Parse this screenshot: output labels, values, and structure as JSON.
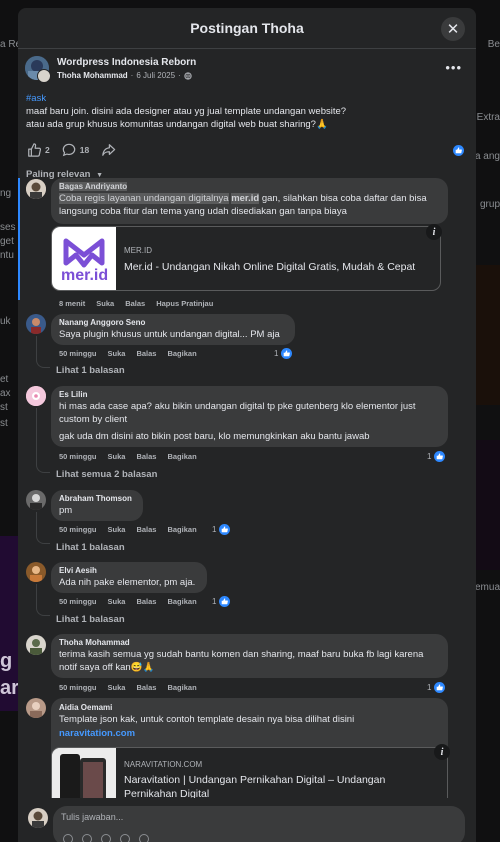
{
  "background": {
    "left_snippets": [
      "a Re",
      "ng",
      "ses",
      "get",
      "ntu",
      "uk",
      "et",
      "ax",
      "st",
      "st",
      "g b",
      "ar"
    ],
    "right_snippets": [
      "Be",
      "Extra",
      "a ang",
      "grup",
      "emua"
    ]
  },
  "modal": {
    "title": "Postingan Thoha",
    "close_icon": "close-icon"
  },
  "post": {
    "group_name": "Wordpress Indonesia Reborn",
    "author": "Thoha Mohammad",
    "date": "6 Juli 2025",
    "audience_icon": "globe-icon",
    "hashtag": "#ask",
    "lines": [
      "maaf baru join. disini ada designer atau yg jual template undangan website?",
      "atau ada grup khusus komunitas undangan digital web buat sharing?🙏"
    ],
    "like_count": "2",
    "comment_count": "18",
    "sort_label": "Paling relevan"
  },
  "comments": [
    {
      "author": "Bagas Andriyanto",
      "text_highlight": "Coba regis layanan undangan digitalnya",
      "text_highlight_bold": "mer.id",
      "text_rest": " gan, silahkan bisa coba daftar dan bisa langsung coba fitur dan tema yang udah disediakan gan tanpa biaya",
      "preview_domain": "MER.ID",
      "preview_title": "Mer.id - Undangan Nikah Online Digital Gratis, Mudah & Cepat",
      "preview_logo_text": "mer.id",
      "time": "8 menit",
      "like": "Suka",
      "reply": "Balas",
      "extra": "Hapus Pratinjau"
    },
    {
      "author": "Nanang Anggoro Seno",
      "text": "Saya plugin khusus untuk undangan digital... PM aja",
      "time": "50 minggu",
      "like": "Suka",
      "reply": "Balas",
      "share": "Bagikan",
      "likes": "1",
      "replies_link": "Lihat 1 balasan"
    },
    {
      "author": "Es Lilin",
      "text_1": "hi mas ada case apa? aku bikin undangan digital tp pke gutenberg klo elementor just custom by client",
      "text_2": "gak uda dm disini ato bikin post baru, klo memungkinkan aku bantu jawab",
      "time": "50 minggu",
      "like": "Suka",
      "reply": "Balas",
      "share": "Bagikan",
      "likes": "1",
      "replies_link": "Lihat semua 2 balasan"
    },
    {
      "author": "Abraham Thomson",
      "text": "pm",
      "time": "50 minggu",
      "like": "Suka",
      "reply": "Balas",
      "share": "Bagikan",
      "likes": "1",
      "replies_link": "Lihat 1 balasan"
    },
    {
      "author": "Elvi Aesih",
      "text": "Ada nih pake elementor, pm aja.",
      "time": "50 minggu",
      "like": "Suka",
      "reply": "Balas",
      "share": "Bagikan",
      "likes": "1",
      "replies_link": "Lihat 1 balasan"
    },
    {
      "author": "Thoha Mohammad",
      "text": "terima kasih semua yg sudah bantu komen dan sharing, maaf baru buka fb lagi karena notif saya off kan😅🙏",
      "time": "50 minggu",
      "like": "Suka",
      "reply": "Balas",
      "share": "Bagikan",
      "likes": "1"
    },
    {
      "author": "Aidia Oemami",
      "text": "Template json kak, untuk contoh template desain nya bisa dilihat disini",
      "link": "naravitation.com",
      "preview_domain": "NARAVITATION.COM",
      "preview_title": "Naravitation | Undangan Pernikahan Digital – Undangan Pernikahan Digital"
    }
  ],
  "reply_box": {
    "placeholder": "Tulis jawaban..."
  },
  "colors": {
    "background": "#242526",
    "bubble": "#3a3b3c",
    "accent_blue": "#2d88ff",
    "link_blue": "#4599ff",
    "text_primary": "#e4e6eb",
    "text_secondary": "#b0b3b8",
    "merid_purple": "#7b4fd6"
  }
}
